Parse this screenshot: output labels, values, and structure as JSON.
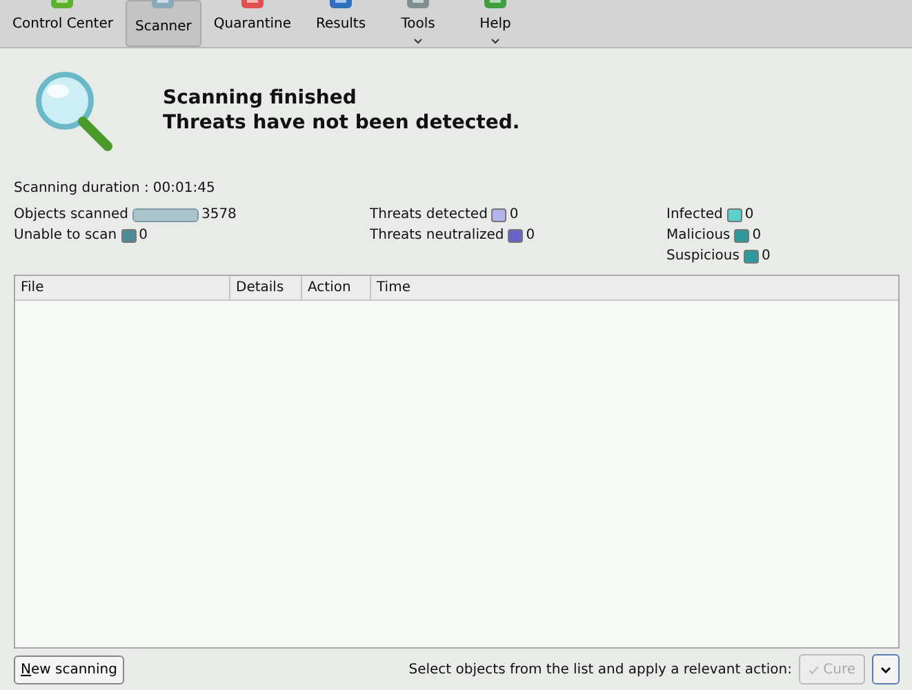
{
  "toolbar": [
    {
      "label": "Control Center",
      "selected": false,
      "menu": false
    },
    {
      "label": "Scanner",
      "selected": true,
      "menu": false
    },
    {
      "label": "Quarantine",
      "selected": false,
      "menu": false
    },
    {
      "label": "Results",
      "selected": false,
      "menu": false
    },
    {
      "label": "Tools",
      "selected": false,
      "menu": true
    },
    {
      "label": "Help",
      "selected": false,
      "menu": true
    }
  ],
  "status": {
    "title": "Scanning finished",
    "message": "Threats have not been detected."
  },
  "duration": {
    "label": "Scanning duration :",
    "value": "00:01:45"
  },
  "stat_columns": [
    [
      {
        "kind": "bar",
        "label": "Objects scanned",
        "value": "3578",
        "level": 1,
        "color": "#a9c4cc"
      },
      {
        "kind": "swatch",
        "label": "Unable to scan",
        "value": "0",
        "color": "#4f8a98"
      }
    ],
    [
      {
        "kind": "swatch",
        "label": "Threats detected",
        "value": "0",
        "color": "#b4b4ec"
      },
      {
        "kind": "swatch",
        "label": "Threats neutralized",
        "value": "0",
        "color": "#6a62c8"
      }
    ],
    [
      {
        "kind": "swatch",
        "label": "Infected",
        "value": "0",
        "color": "#5cd0cc"
      },
      {
        "kind": "swatch",
        "label": "Malicious",
        "value": "0",
        "color": "#2e9a9c"
      },
      {
        "kind": "swatch",
        "label": "Suspicious",
        "value": "0",
        "color": "#2e9a9c"
      }
    ]
  ],
  "table": {
    "columns": [
      "File",
      "Details",
      "Action",
      "Time"
    ]
  },
  "footer": {
    "new_button": "New scanning",
    "hint": "Select objects from the list and apply a relevant action:",
    "action_button": {
      "label": "Cure",
      "disabled": true
    }
  }
}
